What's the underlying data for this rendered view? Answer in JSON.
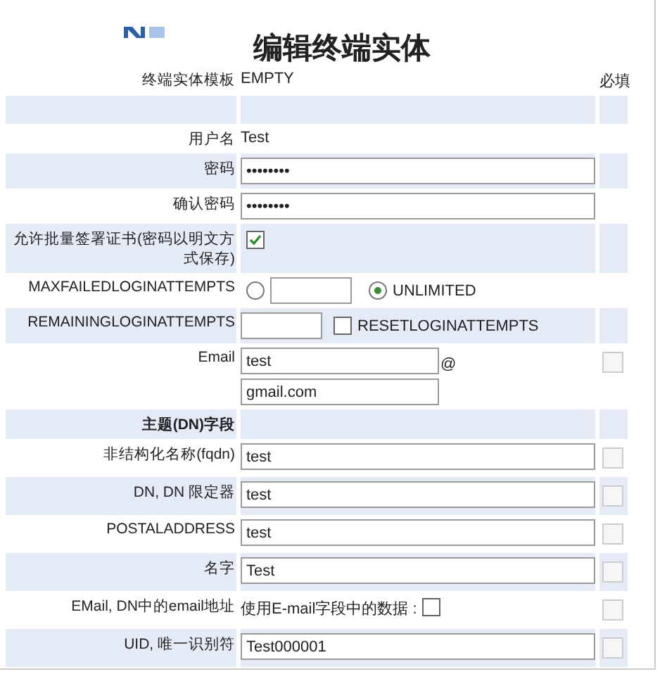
{
  "title": "编辑终端实体",
  "header": {
    "label": "终端实体模板",
    "value": "EMPTY",
    "required_heading": "必填"
  },
  "rows": [
    {
      "kind": "spacer"
    },
    {
      "kind": "text",
      "label": "用户名",
      "value": "Test"
    },
    {
      "kind": "input",
      "label": "密码",
      "value": "••••••••"
    },
    {
      "kind": "input",
      "label": "确认密码",
      "value": "••••••••"
    },
    {
      "kind": "checkbox",
      "label": "允许批量签署证书(密码以明文方式保存)",
      "checked": true
    },
    {
      "kind": "maxfailed",
      "label": "MAXFAILEDLOGINATTEMPTS",
      "options": [
        {
          "selected": false
        },
        {
          "label": "UNLIMITED",
          "selected": true
        }
      ]
    },
    {
      "kind": "remaining",
      "label": "REMAININGLOGINATTEMPTS",
      "option": "RESETLOGINATTEMPTS",
      "checked": false
    },
    {
      "kind": "email",
      "label": "Email",
      "user": "test",
      "at": "@",
      "domain": "gmail.com",
      "required": false
    },
    {
      "kind": "section",
      "label": "主题(DN)字段"
    },
    {
      "kind": "input",
      "label": "非结构化名称(fqdn)",
      "value": "test",
      "required": false
    },
    {
      "kind": "input",
      "label": "DN, DN 限定器",
      "value": "test",
      "required": false
    },
    {
      "kind": "input",
      "label": "POSTALADDRESS",
      "value": "test",
      "required": false
    },
    {
      "kind": "input",
      "label": "名字",
      "value": "Test",
      "required": false
    },
    {
      "kind": "usemail",
      "label": "EMail, DN中的email地址",
      "option": "使用E-mail字段中的数据 :",
      "checked": false,
      "required": false
    },
    {
      "kind": "input",
      "label": "UID, 唯一识别符",
      "value": "Test000001",
      "required": false
    }
  ]
}
